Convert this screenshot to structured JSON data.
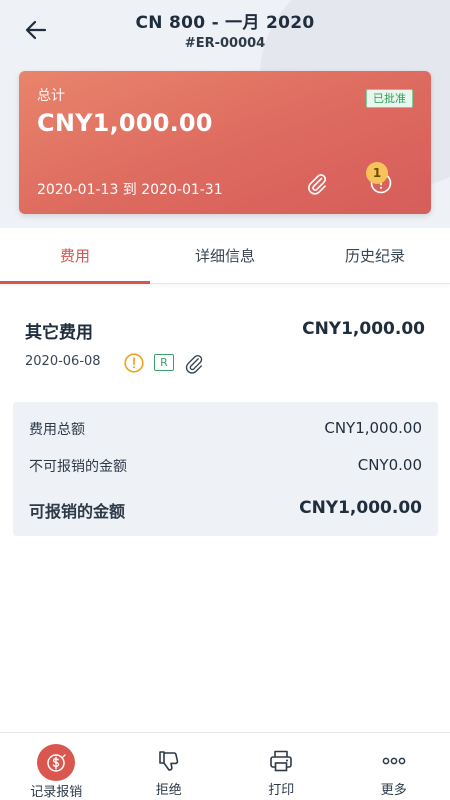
{
  "header": {
    "title": "CN 800 - 一月 2020",
    "report_id": "#ER-00004"
  },
  "card": {
    "total_label": "总计",
    "total_amount": "CNY1,000.00",
    "status_badge": "已批准",
    "date_range": "2020-01-13 到 2020-01-31",
    "warning_count": "1"
  },
  "tabs": [
    {
      "label": "费用",
      "active": true
    },
    {
      "label": "详细信息",
      "active": false
    },
    {
      "label": "历史纪录",
      "active": false
    }
  ],
  "expense": {
    "category": "其它费用",
    "amount": "CNY1,000.00",
    "date": "2020-06-08",
    "receipt_tag": "R"
  },
  "summary": {
    "rows": [
      {
        "label": "费用总额",
        "value": "CNY1,000.00"
      },
      {
        "label": "不可报销的金额",
        "value": "CNY0.00"
      },
      {
        "label": "可报销的金额",
        "value": "CNY1,000.00"
      }
    ]
  },
  "bottom_bar": {
    "items": [
      {
        "label": "记录报销",
        "icon": "record-expense-icon"
      },
      {
        "label": "拒绝",
        "icon": "thumbs-down-icon"
      },
      {
        "label": "打印",
        "icon": "printer-icon"
      },
      {
        "label": "更多",
        "icon": "more-dots-icon"
      }
    ]
  },
  "colors": {
    "accent": "#d9534f",
    "card_gradient_start": "#e9846c",
    "card_gradient_end": "#d65d5b",
    "approved_green": "#2ea15a",
    "warning_amber": "#f0a21a"
  }
}
